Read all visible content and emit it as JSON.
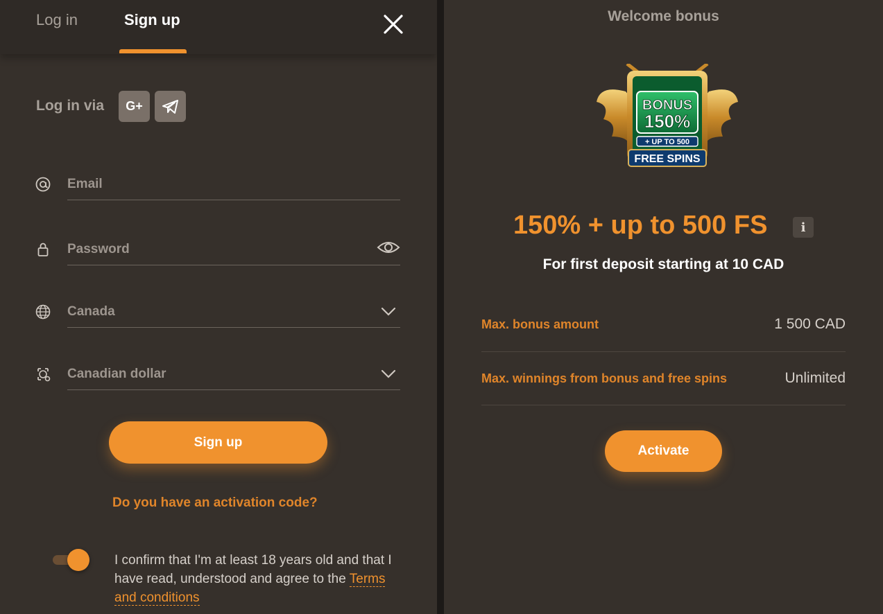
{
  "tabs": {
    "login": "Log in",
    "signup": "Sign up"
  },
  "social": {
    "label": "Log in via",
    "google_text": "G+"
  },
  "form": {
    "email": {
      "placeholder": "Email"
    },
    "password": {
      "placeholder": "Password"
    },
    "country": {
      "value": "Canada"
    },
    "currency": {
      "value": "Canadian dollar"
    },
    "submit_label": "Sign up",
    "activation_link": "Do you have an activation code?",
    "confirm_text": "I confirm that I'm at least 18 years old and that I have read, understood and agree to the ",
    "terms_link": "Terms and conditions",
    "age_toggle_on": true
  },
  "bonus": {
    "title": "Welcome bonus",
    "badge": {
      "line1": "BONUS",
      "line2": "150%",
      "line3": "+ UP TO 500",
      "line4": "FREE SPINS"
    },
    "headline": "150% + up to 500 FS",
    "info_icon": "i",
    "subtitle": "For first deposit starting at 10 CAD",
    "rows": [
      {
        "key": "Max. bonus amount",
        "value": "1 500 CAD"
      },
      {
        "key": "Max. winnings from bonus and free spins",
        "value": "Unlimited"
      }
    ],
    "activate_label": "Activate"
  },
  "colors": {
    "accent": "#f0922e",
    "panel": "#36302b",
    "text_muted": "#9d958e"
  }
}
